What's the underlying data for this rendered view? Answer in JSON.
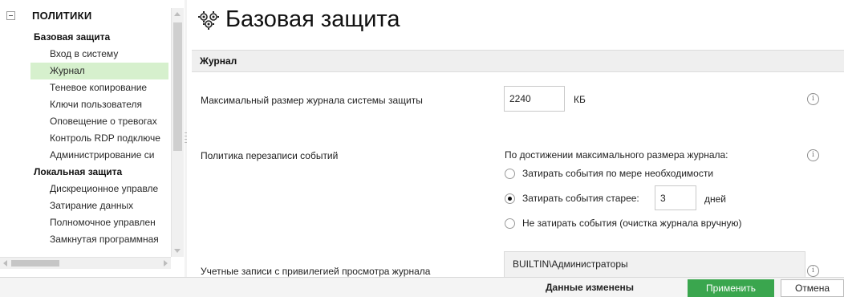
{
  "sidebar": {
    "root_label": "ПОЛИТИКИ",
    "groups": [
      {
        "label": "Базовая защита",
        "items": [
          {
            "label": "Вход в систему",
            "selected": false
          },
          {
            "label": "Журнал",
            "selected": true
          },
          {
            "label": "Теневое копирование",
            "selected": false
          },
          {
            "label": "Ключи пользователя",
            "selected": false
          },
          {
            "label": "Оповещение о тревогах",
            "selected": false
          },
          {
            "label": "Контроль RDP подключе",
            "selected": false
          },
          {
            "label": "Администрирование си",
            "selected": false
          }
        ]
      },
      {
        "label": "Локальная защита",
        "items": [
          {
            "label": "Дискреционное управле",
            "selected": false
          },
          {
            "label": "Затирание данных",
            "selected": false
          },
          {
            "label": "Полномочное управлен",
            "selected": false
          },
          {
            "label": "Замкнутая программная",
            "selected": false
          }
        ]
      }
    ],
    "selected_color": "#d6f0cd"
  },
  "main": {
    "title": "Базовая защита",
    "title_icon": "shield-gears-icon",
    "section": "Журнал",
    "max_size": {
      "label": "Максимальный размер журнала системы защиты",
      "value": "2240",
      "unit": "КБ"
    },
    "overwrite": {
      "label": "Политика перезаписи событий",
      "hint": "По достижении максимального размера журнала:",
      "options": [
        {
          "label": "Затирать события по мере необходимости",
          "checked": false
        },
        {
          "label": "Затирать события старее:",
          "checked": true
        },
        {
          "label": "Не затирать события (очистка журнала вручную)",
          "checked": false
        }
      ],
      "days_value": "3",
      "days_unit": "дней"
    },
    "accounts": {
      "label": "Учетные записи с привилегией просмотра журнала",
      "entries": [
        "BUILTIN\\Администраторы"
      ]
    },
    "info_glyph": "i"
  },
  "footer": {
    "status": "Данные изменены",
    "apply_label": "Применить",
    "cancel_label": "Отмена",
    "apply_color": "#3aa64e"
  }
}
